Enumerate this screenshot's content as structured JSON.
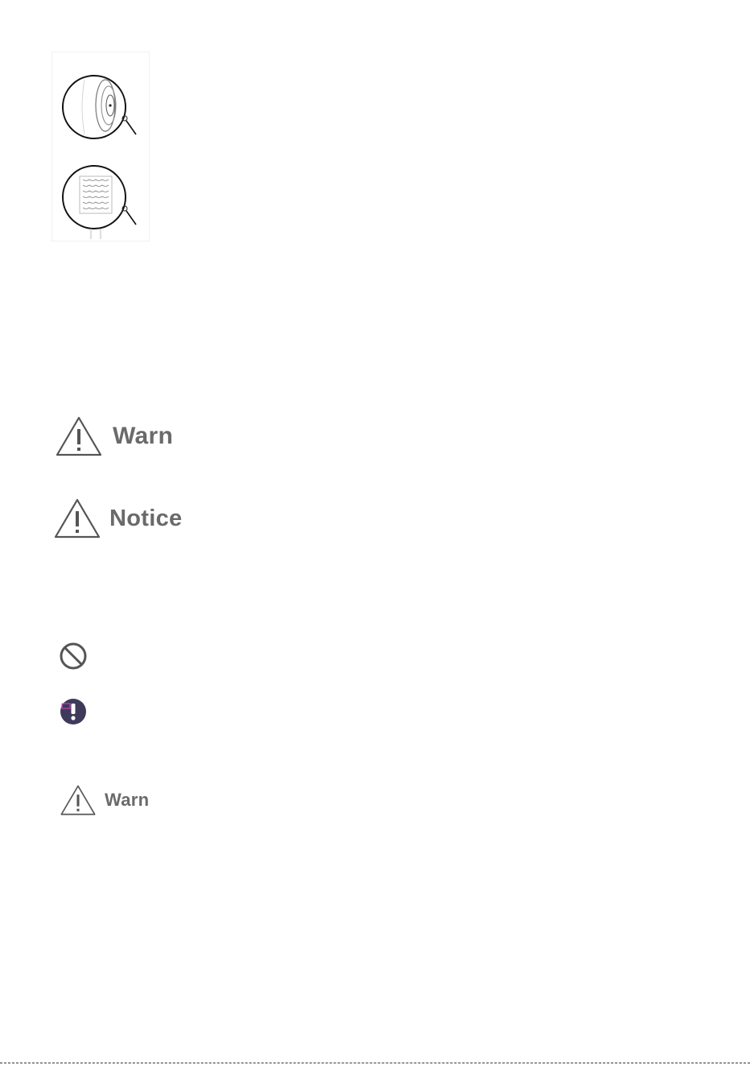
{
  "illustrations": [
    {
      "name": "wheel-side-with-pin",
      "icon": "wheel-side-icon"
    },
    {
      "name": "roller-brush-with-pin",
      "icon": "roller-brush-icon"
    }
  ],
  "signs": {
    "warn": {
      "label": "Warn",
      "icon": "warning-triangle-icon"
    },
    "notice": {
      "label": "Notice",
      "icon": "warning-triangle-icon"
    },
    "prohibited": {
      "icon": "prohibited-icon"
    },
    "mandatory": {
      "icon": "mandatory-exclamation-icon"
    },
    "warn_small": {
      "label": "Warn",
      "icon": "warning-triangle-icon"
    }
  },
  "colors": {
    "label_gray": "#6a6a6a",
    "mandatory_fill": "#3e3a5a",
    "mandatory_accent": "#e040d0"
  }
}
